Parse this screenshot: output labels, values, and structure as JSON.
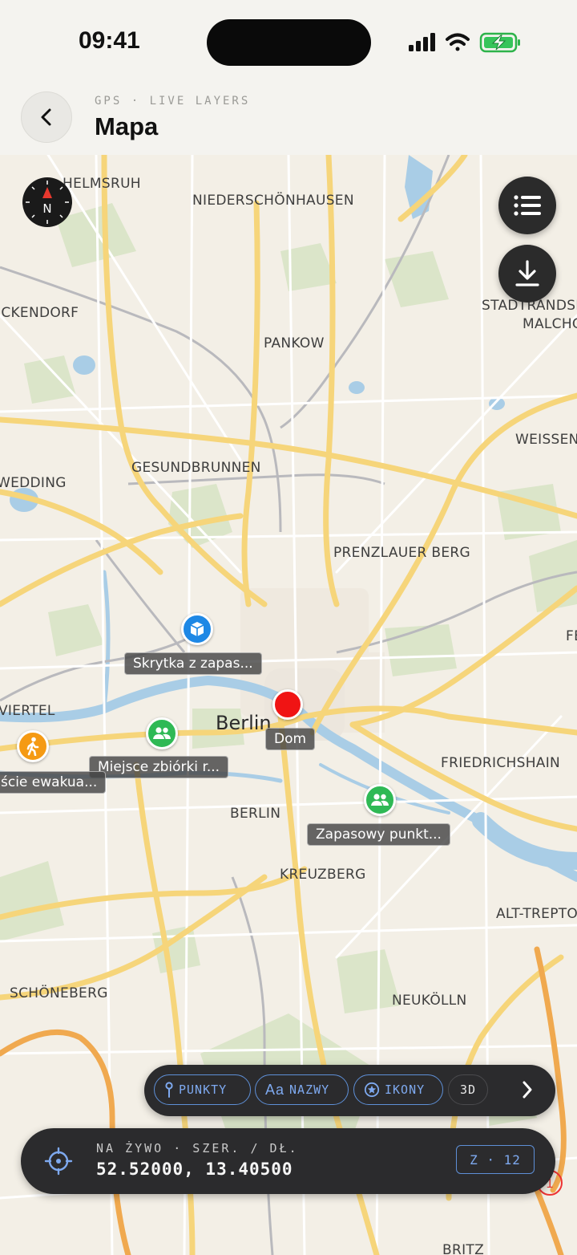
{
  "status_bar": {
    "time": "09:41"
  },
  "header": {
    "subtitle": "GPS · LIVE LAYERS",
    "title": "Mapa"
  },
  "map": {
    "labels": [
      {
        "text": "HELMSRUH",
        "type": "district"
      },
      {
        "text": "NIEDERSCHÖNHAUSEN",
        "type": "district"
      },
      {
        "text": "ICKENDORF",
        "type": "district"
      },
      {
        "text": "STADTRANDSI",
        "type": "district"
      },
      {
        "text": "MALCHO",
        "type": "district"
      },
      {
        "text": "PANKOW",
        "type": "district"
      },
      {
        "text": "WEISSEN",
        "type": "district"
      },
      {
        "text": "GESUNDBRUNNEN",
        "type": "district"
      },
      {
        "text": "WEDDING",
        "type": "district"
      },
      {
        "text": "PRENZLAUER BERG",
        "type": "district"
      },
      {
        "text": "FE",
        "type": "district"
      },
      {
        "text": "VIERTEL",
        "type": "district"
      },
      {
        "text": "Berlin",
        "type": "city"
      },
      {
        "text": "FRIEDRICHSHAIN",
        "type": "district"
      },
      {
        "text": "BERLIN",
        "type": "district"
      },
      {
        "text": "KREUZBERG",
        "type": "district"
      },
      {
        "text": "ALT-TREPTO",
        "type": "district"
      },
      {
        "text": "SCHÖNEBERG",
        "type": "district"
      },
      {
        "text": "NEUKÖLLN",
        "type": "district"
      },
      {
        "text": "BRITZ",
        "type": "district"
      }
    ],
    "markers": [
      {
        "label": "Skrytka z zapas...",
        "icon": "cube-icon",
        "color": "#1e88e5"
      },
      {
        "label": "Dom",
        "icon": "home-dot",
        "color": "#f01414"
      },
      {
        "label": "Miejsce zbiórki r...",
        "icon": "group-icon",
        "color": "#2fb955"
      },
      {
        "label": "ście ewakua...",
        "icon": "walking-icon",
        "color": "#f59a13"
      },
      {
        "label": "Zapasowy punkt...",
        "icon": "group-icon",
        "color": "#2fb955"
      }
    ],
    "compass_letter": "N"
  },
  "layers": {
    "points": "PUNKTY",
    "names_prefix": "Aa",
    "names": "NAZWY",
    "icons": "IKONY",
    "mode3d": "3D"
  },
  "coords": {
    "caption": "NA ŻYWO · SZER. / DŁ.",
    "value": "52.52000, 13.40500",
    "zoom": "Z · 12"
  },
  "colors": {
    "accent": "#5e8fd6",
    "panel": "#2b2b2d",
    "road": "#f6d57a",
    "water": "#a9cde6",
    "park": "#d8e3c6"
  }
}
